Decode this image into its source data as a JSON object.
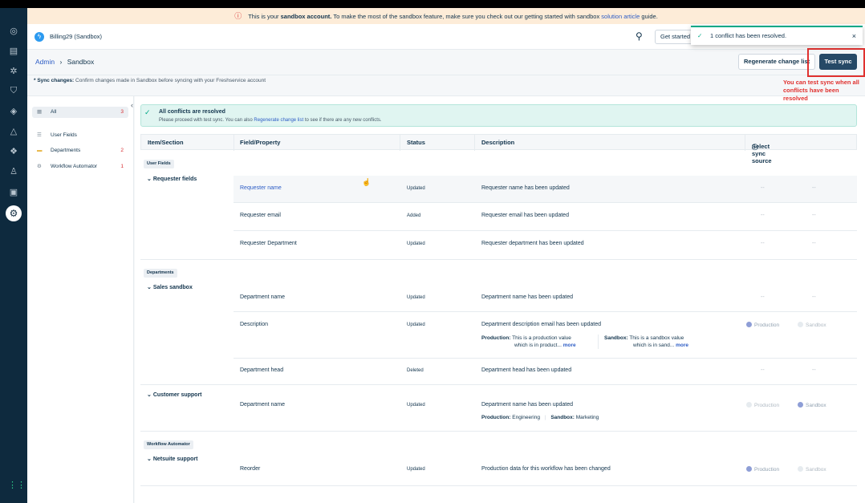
{
  "banner": {
    "prefix": "This is your",
    "bold": "sandbox account.",
    "middle": "To make the most of the sandbox feature, make sure you check out our getting started with sandbox",
    "link": "solution article",
    "suffix": "guide."
  },
  "header": {
    "account": "Billing29 (Sandbox)",
    "get_started": "Get started"
  },
  "toast": {
    "message": "1 conflict has been resolved.",
    "close": "×"
  },
  "breadcrumb": {
    "admin": "Admin",
    "separator": "›",
    "current": "Sandbox"
  },
  "actions": {
    "regenerate": "Regenerate change list",
    "test_sync": "Test sync",
    "annotation": "You can test sync when all conflicts have been resolved"
  },
  "note": {
    "label": "* Sync changes:",
    "text": "Confirm changes made in Sandbox before syncing with your Freshservice account"
  },
  "left_panel": {
    "items": [
      {
        "label": "All",
        "count": "3",
        "icon": "list-icon"
      },
      {
        "label": "User Fields",
        "count": "",
        "icon": "fields-icon"
      },
      {
        "label": "Departments",
        "count": "2",
        "icon": "folder-icon"
      },
      {
        "label": "Workflow Automator",
        "count": "1",
        "icon": "workflow-icon"
      }
    ]
  },
  "success": {
    "title": "All conflicts are resolved",
    "text_a": "Please proceed with test sync. You can also",
    "link": "Regenerate change list",
    "text_b": "to see if there are any new conflicts."
  },
  "table": {
    "headers": [
      "Item/Section",
      "Field/Property",
      "Status",
      "Description",
      "Select sync source"
    ],
    "sections": [
      {
        "tag": "User Fields",
        "group": "Requester fields"
      },
      {
        "tag": "Departments",
        "group": "Sales sandbox",
        "group2": "Customer support"
      },
      {
        "tag": "Workflow Automator",
        "group": "Netsuite support"
      }
    ],
    "rows": [
      {
        "field": "Requester name",
        "status": "Updated",
        "desc": "Requester name has been updated",
        "sync": [
          "--",
          "--"
        ]
      },
      {
        "field": "Requester email",
        "status": "Added",
        "desc": "Requester email has been updated",
        "sync": [
          "--",
          "--"
        ]
      },
      {
        "field": "Requester Department",
        "status": "Updated",
        "desc": "Requester department has been updated",
        "sync": [
          "--",
          "--"
        ]
      },
      {
        "field": "Department name",
        "status": "Updated",
        "desc": "Department name has been updated",
        "sync": [
          "--",
          "--"
        ]
      },
      {
        "field": "Description",
        "status": "Updated",
        "desc": "Department description email has been updated",
        "prod_label": "Production:",
        "prod_val1": "This is a production value",
        "prod_val2": "which is in product...",
        "sb_label": "Sandbox:",
        "sb_val1": "This is a sandbox value",
        "sb_val2": "which is in sand...",
        "more": "more",
        "radio": [
          "Production",
          "Sandbox"
        ],
        "selected": "Production"
      },
      {
        "field": "Department head",
        "status": "Deleted",
        "desc": "Department head has been updated",
        "sync": [
          "--",
          "--"
        ]
      },
      {
        "field": "Department name",
        "status": "Updated",
        "desc": "Department name has been updated",
        "prod_label": "Production:",
        "prod_val": "Engineering",
        "sb_label": "Sandbox:",
        "sb_val": "Marketing",
        "radio": [
          "Production",
          "Sandbox"
        ],
        "selected": "Sandbox"
      },
      {
        "field": "Reorder",
        "status": "Updated",
        "desc": "Production data for this workflow has been changed",
        "radio": [
          "Production",
          "Sandbox"
        ],
        "selected": "Production"
      }
    ]
  }
}
